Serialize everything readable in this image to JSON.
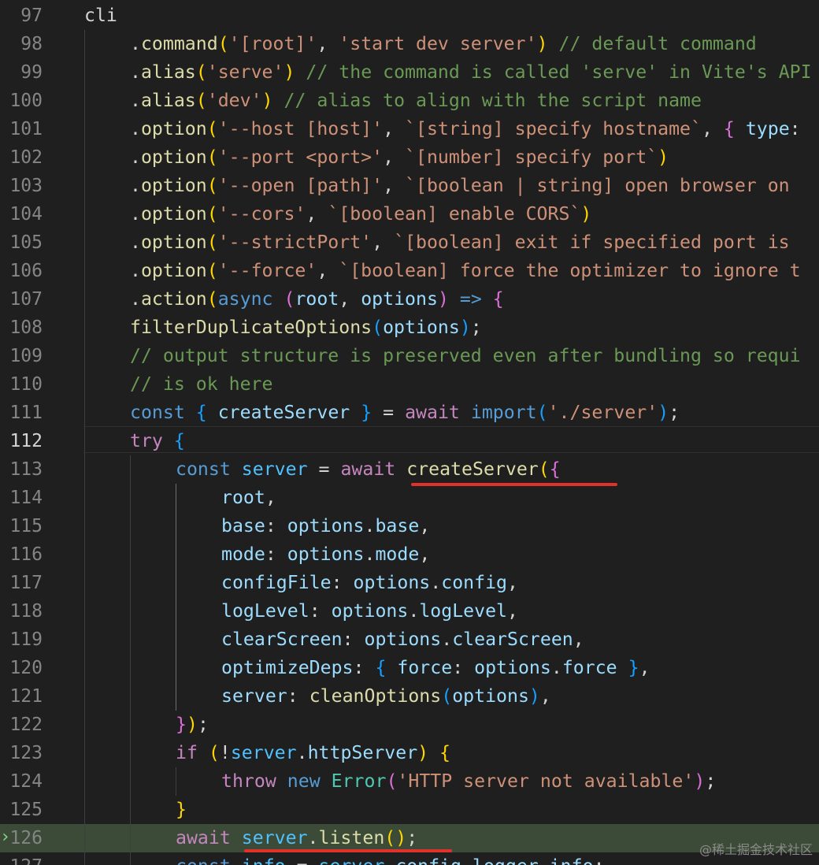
{
  "editor": {
    "watermark": "@稀土掘金技术社区",
    "active_line": 112,
    "debug_line": 126
  },
  "lines": [
    {
      "num": "97",
      "indent": 1,
      "tokens": [
        [
          "cli",
          "plain"
        ]
      ]
    },
    {
      "num": "98",
      "indent": 2,
      "tokens": [
        [
          ".",
          "plain"
        ],
        [
          "command",
          "func"
        ],
        [
          "(",
          "b1"
        ],
        [
          "'[root]'",
          "str"
        ],
        [
          ", ",
          "plain"
        ],
        [
          "'start dev server'",
          "str"
        ],
        [
          ")",
          "b1"
        ],
        [
          " // default command",
          "cmt"
        ]
      ]
    },
    {
      "num": "99",
      "indent": 2,
      "tokens": [
        [
          ".",
          "plain"
        ],
        [
          "alias",
          "func"
        ],
        [
          "(",
          "b1"
        ],
        [
          "'serve'",
          "str"
        ],
        [
          ")",
          "b1"
        ],
        [
          " // the command is called 'serve' in Vite's API",
          "cmt"
        ]
      ]
    },
    {
      "num": "100",
      "indent": 2,
      "tokens": [
        [
          ".",
          "plain"
        ],
        [
          "alias",
          "func"
        ],
        [
          "(",
          "b1"
        ],
        [
          "'dev'",
          "str"
        ],
        [
          ")",
          "b1"
        ],
        [
          " // alias to align with the script name",
          "cmt"
        ]
      ]
    },
    {
      "num": "101",
      "indent": 2,
      "tokens": [
        [
          ".",
          "plain"
        ],
        [
          "option",
          "func"
        ],
        [
          "(",
          "b1"
        ],
        [
          "'--host [host]'",
          "str"
        ],
        [
          ", ",
          "plain"
        ],
        [
          "`[string] specify hostname`",
          "str"
        ],
        [
          ", ",
          "plain"
        ],
        [
          "{",
          "b2"
        ],
        [
          " ",
          "plain"
        ],
        [
          "type",
          "var"
        ],
        [
          ":",
          "plain"
        ]
      ]
    },
    {
      "num": "102",
      "indent": 2,
      "tokens": [
        [
          ".",
          "plain"
        ],
        [
          "option",
          "func"
        ],
        [
          "(",
          "b1"
        ],
        [
          "'--port <port>'",
          "str"
        ],
        [
          ", ",
          "plain"
        ],
        [
          "`[number] specify port`",
          "str"
        ],
        [
          ")",
          "b1"
        ]
      ]
    },
    {
      "num": "103",
      "indent": 2,
      "tokens": [
        [
          ".",
          "plain"
        ],
        [
          "option",
          "func"
        ],
        [
          "(",
          "b1"
        ],
        [
          "'--open [path]'",
          "str"
        ],
        [
          ", ",
          "plain"
        ],
        [
          "`[boolean | string] open browser on",
          "str"
        ]
      ]
    },
    {
      "num": "104",
      "indent": 2,
      "tokens": [
        [
          ".",
          "plain"
        ],
        [
          "option",
          "func"
        ],
        [
          "(",
          "b1"
        ],
        [
          "'--cors'",
          "str"
        ],
        [
          ", ",
          "plain"
        ],
        [
          "`[boolean] enable CORS`",
          "str"
        ],
        [
          ")",
          "b1"
        ]
      ]
    },
    {
      "num": "105",
      "indent": 2,
      "tokens": [
        [
          ".",
          "plain"
        ],
        [
          "option",
          "func"
        ],
        [
          "(",
          "b1"
        ],
        [
          "'--strictPort'",
          "str"
        ],
        [
          ", ",
          "plain"
        ],
        [
          "`[boolean] exit if specified port is",
          "str"
        ]
      ]
    },
    {
      "num": "106",
      "indent": 2,
      "tokens": [
        [
          ".",
          "plain"
        ],
        [
          "option",
          "func"
        ],
        [
          "(",
          "b1"
        ],
        [
          "'--force'",
          "str"
        ],
        [
          ", ",
          "plain"
        ],
        [
          "`[boolean] force the optimizer to ignore t",
          "str"
        ]
      ]
    },
    {
      "num": "107",
      "indent": 2,
      "tokens": [
        [
          ".",
          "plain"
        ],
        [
          "action",
          "func"
        ],
        [
          "(",
          "b1"
        ],
        [
          "async",
          "kw"
        ],
        [
          " ",
          "plain"
        ],
        [
          "(",
          "b2"
        ],
        [
          "root",
          "var"
        ],
        [
          ", ",
          "plain"
        ],
        [
          "options",
          "var"
        ],
        [
          ")",
          "b2"
        ],
        [
          " ",
          "plain"
        ],
        [
          "=>",
          "kw"
        ],
        [
          " ",
          "plain"
        ],
        [
          "{",
          "b2"
        ]
      ]
    },
    {
      "num": "108",
      "indent": 2,
      "tokens": [
        [
          "filterDuplicateOptions",
          "func"
        ],
        [
          "(",
          "b3"
        ],
        [
          "options",
          "var"
        ],
        [
          ")",
          "b3"
        ],
        [
          ";",
          "plain"
        ]
      ]
    },
    {
      "num": "109",
      "indent": 2,
      "tokens": [
        [
          "// output structure is preserved even after bundling so requi",
          "cmt"
        ]
      ]
    },
    {
      "num": "110",
      "indent": 2,
      "tokens": [
        [
          "// is ok here",
          "cmt"
        ]
      ]
    },
    {
      "num": "111",
      "indent": 2,
      "tokens": [
        [
          "const",
          "kw"
        ],
        [
          " ",
          "plain"
        ],
        [
          "{",
          "b3"
        ],
        [
          " ",
          "plain"
        ],
        [
          "createServer",
          "var"
        ],
        [
          " ",
          "plain"
        ],
        [
          "}",
          "b3"
        ],
        [
          " = ",
          "plain"
        ],
        [
          "await",
          "ctrl"
        ],
        [
          " ",
          "plain"
        ],
        [
          "import",
          "kw"
        ],
        [
          "(",
          "b3"
        ],
        [
          "'./server'",
          "str"
        ],
        [
          ")",
          "b3"
        ],
        [
          ";",
          "plain"
        ]
      ]
    },
    {
      "num": "112",
      "indent": 2,
      "tokens": [
        [
          "try",
          "ctrl"
        ],
        [
          " ",
          "plain"
        ],
        [
          "{",
          "b3"
        ]
      ]
    },
    {
      "num": "113",
      "indent": 3,
      "tokens": [
        [
          "const",
          "kw"
        ],
        [
          " ",
          "plain"
        ],
        [
          "server",
          "const"
        ],
        [
          " = ",
          "plain"
        ],
        [
          "await",
          "ctrl"
        ],
        [
          " ",
          "plain"
        ],
        [
          "createServer",
          "func"
        ],
        [
          "(",
          "b1"
        ],
        [
          "{",
          "b2"
        ]
      ]
    },
    {
      "num": "114",
      "indent": 4,
      "tokens": [
        [
          "root",
          "var"
        ],
        [
          ",",
          "plain"
        ]
      ]
    },
    {
      "num": "115",
      "indent": 4,
      "tokens": [
        [
          "base",
          "var"
        ],
        [
          ": ",
          "plain"
        ],
        [
          "options",
          "var"
        ],
        [
          ".",
          "plain"
        ],
        [
          "base",
          "var"
        ],
        [
          ",",
          "plain"
        ]
      ]
    },
    {
      "num": "116",
      "indent": 4,
      "tokens": [
        [
          "mode",
          "var"
        ],
        [
          ": ",
          "plain"
        ],
        [
          "options",
          "var"
        ],
        [
          ".",
          "plain"
        ],
        [
          "mode",
          "var"
        ],
        [
          ",",
          "plain"
        ]
      ]
    },
    {
      "num": "117",
      "indent": 4,
      "tokens": [
        [
          "configFile",
          "var"
        ],
        [
          ": ",
          "plain"
        ],
        [
          "options",
          "var"
        ],
        [
          ".",
          "plain"
        ],
        [
          "config",
          "var"
        ],
        [
          ",",
          "plain"
        ]
      ]
    },
    {
      "num": "118",
      "indent": 4,
      "tokens": [
        [
          "logLevel",
          "var"
        ],
        [
          ": ",
          "plain"
        ],
        [
          "options",
          "var"
        ],
        [
          ".",
          "plain"
        ],
        [
          "logLevel",
          "var"
        ],
        [
          ",",
          "plain"
        ]
      ]
    },
    {
      "num": "119",
      "indent": 4,
      "tokens": [
        [
          "clearScreen",
          "var"
        ],
        [
          ": ",
          "plain"
        ],
        [
          "options",
          "var"
        ],
        [
          ".",
          "plain"
        ],
        [
          "clearScreen",
          "var"
        ],
        [
          ",",
          "plain"
        ]
      ]
    },
    {
      "num": "120",
      "indent": 4,
      "tokens": [
        [
          "optimizeDeps",
          "var"
        ],
        [
          ": ",
          "plain"
        ],
        [
          "{",
          "b3"
        ],
        [
          " ",
          "plain"
        ],
        [
          "force",
          "var"
        ],
        [
          ": ",
          "plain"
        ],
        [
          "options",
          "var"
        ],
        [
          ".",
          "plain"
        ],
        [
          "force",
          "var"
        ],
        [
          " ",
          "plain"
        ],
        [
          "}",
          "b3"
        ],
        [
          ",",
          "plain"
        ]
      ]
    },
    {
      "num": "121",
      "indent": 4,
      "tokens": [
        [
          "server",
          "var"
        ],
        [
          ": ",
          "plain"
        ],
        [
          "cleanOptions",
          "func"
        ],
        [
          "(",
          "b3"
        ],
        [
          "options",
          "var"
        ],
        [
          ")",
          "b3"
        ],
        [
          ",",
          "plain"
        ]
      ]
    },
    {
      "num": "122",
      "indent": 3,
      "tokens": [
        [
          "}",
          "b2"
        ],
        [
          ")",
          "b1"
        ],
        [
          ";",
          "plain"
        ]
      ]
    },
    {
      "num": "123",
      "indent": 3,
      "tokens": [
        [
          "if",
          "ctrl"
        ],
        [
          " ",
          "plain"
        ],
        [
          "(",
          "b1"
        ],
        [
          "!",
          "plain"
        ],
        [
          "server",
          "const"
        ],
        [
          ".",
          "plain"
        ],
        [
          "httpServer",
          "var"
        ],
        [
          ")",
          "b1"
        ],
        [
          " ",
          "plain"
        ],
        [
          "{",
          "b1"
        ]
      ]
    },
    {
      "num": "124",
      "indent": 4,
      "tokens": [
        [
          "throw",
          "ctrl"
        ],
        [
          " ",
          "plain"
        ],
        [
          "new",
          "kw"
        ],
        [
          " ",
          "plain"
        ],
        [
          "Error",
          "cls"
        ],
        [
          "(",
          "b2"
        ],
        [
          "'HTTP server not available'",
          "str"
        ],
        [
          ")",
          "b2"
        ],
        [
          ";",
          "plain"
        ]
      ]
    },
    {
      "num": "125",
      "indent": 3,
      "tokens": [
        [
          "}",
          "b1"
        ]
      ]
    },
    {
      "num": "126",
      "indent": 3,
      "tokens": [
        [
          "await",
          "ctrl"
        ],
        [
          " ",
          "plain"
        ],
        [
          "server",
          "const"
        ],
        [
          ".",
          "plain"
        ],
        [
          "listen",
          "func"
        ],
        [
          "(",
          "b1"
        ],
        [
          ")",
          "b1"
        ],
        [
          ";",
          "plain"
        ]
      ]
    },
    {
      "num": "127",
      "indent": 3,
      "tokens": [
        [
          "const",
          "kw"
        ],
        [
          " ",
          "plain"
        ],
        [
          "info",
          "const"
        ],
        [
          " = ",
          "plain"
        ],
        [
          "server",
          "const"
        ],
        [
          ".",
          "plain"
        ],
        [
          "config",
          "var"
        ],
        [
          ".",
          "plain"
        ],
        [
          "logger",
          "var"
        ],
        [
          ".",
          "plain"
        ],
        [
          "info",
          "var"
        ],
        [
          ";",
          "plain"
        ]
      ]
    }
  ]
}
